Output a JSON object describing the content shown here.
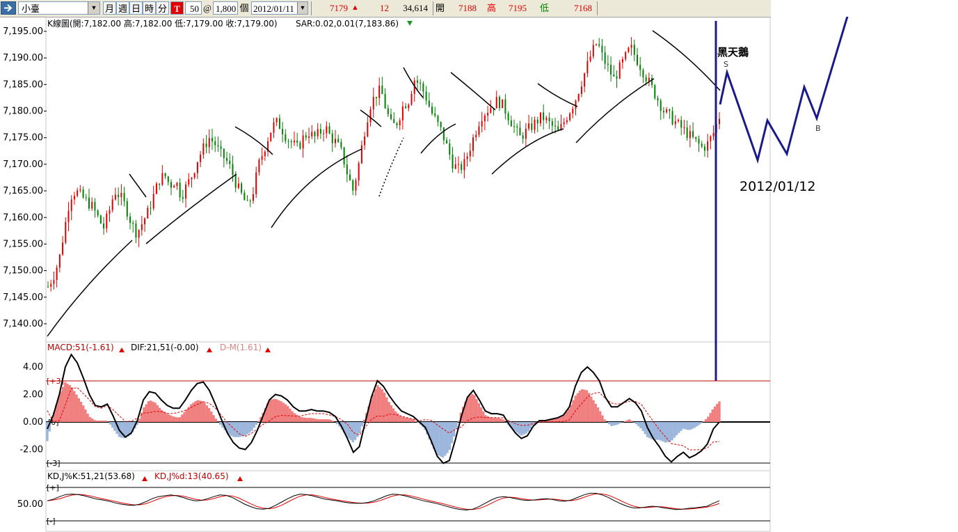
{
  "toolbar": {
    "symbol": "小臺",
    "periods": [
      "月",
      "週",
      "日",
      "時",
      "分"
    ],
    "mark": "T",
    "interval": "50",
    "at": "@",
    "count": "1,800",
    "count_unit": "個",
    "date": "2012/01/11",
    "last_price": "7179",
    "change": "12",
    "volume": "34,614",
    "open_label": "開",
    "open": "7188",
    "high_label": "高",
    "high": "7195",
    "low_label": "低",
    "low": "7168"
  },
  "colors": {
    "up": "#e00000",
    "down": "#008000",
    "accent_blue": "#1a1a8c",
    "macd_pos": "#f08080",
    "macd_neg": "#9cb6dc"
  },
  "icons": {
    "arrow": "right-arrow-icon",
    "dropdown": "chevron-down-icon",
    "up": "triangle-up-icon",
    "down": "triangle-down-icon"
  },
  "price_panel": {
    "header": "K線圖(開:7,182.00 高:7,182.00 低:7,179.00 收:7,179.00)",
    "sar": "SAR:0.02,0.01(7,183.86)",
    "y_ticks": [
      "7,195.00",
      "7,190.00",
      "7,185.00",
      "7,180.00",
      "7,175.00",
      "7,170.00",
      "7,165.00",
      "7,160.00",
      "7,155.00",
      "7,150.00",
      "7,145.00",
      "7,140.00"
    ],
    "annotation_title": "黑天鵝",
    "annotation_s": "S",
    "annotation_b": "B",
    "annotation_date": "2012/01/12"
  },
  "macd_panel": {
    "label1": "MACD:51(-1.61)",
    "label2": "DIF:21,51(-0.00)",
    "label3": "D-M(1.61)",
    "y_ticks": [
      "4.00",
      "2.00",
      "0.00",
      "-2.00"
    ],
    "band_upper": "[+3]",
    "band_zero": "[0]",
    "band_lower": "[-3]"
  },
  "kd_panel": {
    "label1": "KD,J%K:51,21(53.68)",
    "label2": "KD,J%d:13(40.65)",
    "y_ticks": [
      "50.00"
    ],
    "band_upper": "[+]",
    "band_lower": "[-]"
  },
  "chart_data": {
    "type": "candlestick",
    "ylim": [
      7137,
      7197
    ],
    "close_path": [
      7147,
      7149,
      7152,
      7158,
      7164,
      7165,
      7164,
      7163,
      7162,
      7160,
      7158,
      7161,
      7165,
      7164,
      7162,
      7159,
      7157,
      7159,
      7161,
      7164,
      7167,
      7168,
      7166,
      7167,
      7164,
      7166,
      7168,
      7171,
      7173,
      7175,
      7174,
      7172,
      7171,
      7169,
      7166,
      7164,
      7162,
      7165,
      7170,
      7173,
      7176,
      7178,
      7177,
      7175,
      7174,
      7173,
      7175,
      7176,
      7175,
      7176,
      7177,
      7175,
      7174,
      7172,
      7168,
      7165,
      7170,
      7176,
      7181,
      7183,
      7184,
      7180,
      7177,
      7178,
      7181,
      7182,
      7186,
      7185,
      7183,
      7180,
      7178,
      7176,
      7173,
      7170,
      7169,
      7170,
      7173,
      7176,
      7179,
      7180,
      7181,
      7182,
      7181,
      7179,
      7177,
      7175,
      7176,
      7177,
      7178,
      7179,
      7178,
      7177,
      7176,
      7178,
      7180,
      7182,
      7185,
      7188,
      7191,
      7193,
      7190,
      7188,
      7186,
      7188,
      7190,
      7192,
      7190,
      7188,
      7186,
      7184,
      7182,
      7180,
      7179,
      7178,
      7177,
      7176,
      7175,
      7174,
      7173,
      7174,
      7176,
      7179
    ],
    "macd_dif": [
      -0.5,
      0.5,
      2.0,
      4.0,
      4.9,
      4.3,
      3.2,
      2.0,
      1.2,
      1.1,
      1.3,
      0.4,
      -0.6,
      -1.1,
      -0.8,
      0.1,
      1.6,
      2.2,
      2.1,
      1.6,
      1.2,
      1.0,
      1.0,
      1.6,
      2.3,
      2.8,
      2.9,
      2.3,
      1.3,
      0.2,
      -0.8,
      -1.5,
      -1.9,
      -2.0,
      -1.5,
      -0.6,
      0.5,
      1.6,
      2.0,
      1.9,
      1.6,
      1.1,
      0.8,
      0.8,
      0.9,
      0.8,
      0.8,
      0.7,
      0.4,
      -0.3,
      -1.2,
      -2.2,
      -1.8,
      0.0,
      1.8,
      3.0,
      2.6,
      1.9,
      1.3,
      0.8,
      0.6,
      0.4,
      0.0,
      -0.4,
      -1.4,
      -2.5,
      -3.0,
      -2.8,
      -1.3,
      0.4,
      1.8,
      2.3,
      1.6,
      0.8,
      0.6,
      0.6,
      0.5,
      -0.2,
      -0.8,
      -1.2,
      -1.0,
      -0.3,
      0.1,
      0.1,
      0.2,
      0.3,
      0.5,
      1.1,
      2.6,
      3.6,
      4.0,
      3.6,
      3.0,
      1.8,
      1.1,
      1.1,
      1.4,
      1.7,
      1.4,
      0.8,
      -0.4,
      -1.2,
      -1.8,
      -2.5,
      -2.9,
      -2.5,
      -2.2,
      -2.6,
      -2.4,
      -2.1,
      -1.6,
      -0.5,
      0.0
    ],
    "macd_hist": [
      -1.4,
      0.5,
      2.0,
      2.9,
      2.6,
      1.9,
      1.2,
      0.4,
      0.1,
      0.1,
      0.1,
      -0.5,
      -1.1,
      -1.2,
      -0.9,
      -0.2,
      1.0,
      1.6,
      1.4,
      0.9,
      0.6,
      0.4,
      0.3,
      0.8,
      1.3,
      1.6,
      1.5,
      1.0,
      0.3,
      -0.3,
      -0.8,
      -1.1,
      -1.1,
      -1.0,
      -0.7,
      -0.1,
      0.7,
      1.6,
      1.7,
      1.5,
      1.2,
      0.7,
      0.4,
      0.3,
      0.3,
      0.2,
      0.2,
      0.2,
      0.0,
      -0.5,
      -1.1,
      -1.5,
      -0.9,
      0.4,
      1.7,
      2.7,
      2.3,
      1.4,
      0.8,
      0.4,
      0.3,
      0.2,
      -0.1,
      -0.6,
      -1.6,
      -2.4,
      -2.6,
      -2.1,
      -0.8,
      0.8,
      1.8,
      2.1,
      1.3,
      0.5,
      0.3,
      0.3,
      0.2,
      -0.3,
      -0.7,
      -1.0,
      -0.8,
      -0.2,
      0.1,
      0.1,
      0.2,
      0.3,
      0.5,
      1.0,
      1.9,
      2.4,
      2.3,
      1.6,
      0.9,
      0.1,
      -0.3,
      -0.2,
      0.0,
      0.2,
      -0.1,
      -0.5,
      -1.1,
      -1.3,
      -1.3,
      -1.5,
      -1.4,
      -0.9,
      -0.5,
      -0.6,
      -0.4,
      -0.1,
      0.3,
      1.0,
      1.5
    ],
    "kd_k": [
      58,
      62,
      68,
      73,
      74,
      73,
      70,
      66,
      62,
      60,
      57,
      53,
      50,
      48,
      47,
      50,
      56,
      63,
      68,
      70,
      72,
      70,
      66,
      61,
      58,
      59,
      63,
      68,
      72,
      71,
      66,
      58,
      50,
      44,
      39,
      38,
      40,
      47,
      55,
      63,
      70,
      74,
      73,
      70,
      66,
      62,
      60,
      58,
      55,
      53,
      52,
      52,
      54,
      58,
      64,
      70,
      74,
      73,
      70,
      66,
      62,
      58,
      55,
      52,
      48,
      44,
      40,
      37,
      36,
      38,
      44,
      52,
      60,
      66,
      68,
      66,
      63,
      60,
      59,
      60,
      62,
      63,
      61,
      58,
      57,
      60,
      66,
      72,
      76,
      76,
      72,
      66,
      58,
      51,
      45,
      41,
      41,
      43,
      45,
      44,
      41,
      39,
      37,
      38,
      40,
      41,
      43,
      45,
      52,
      58
    ]
  }
}
